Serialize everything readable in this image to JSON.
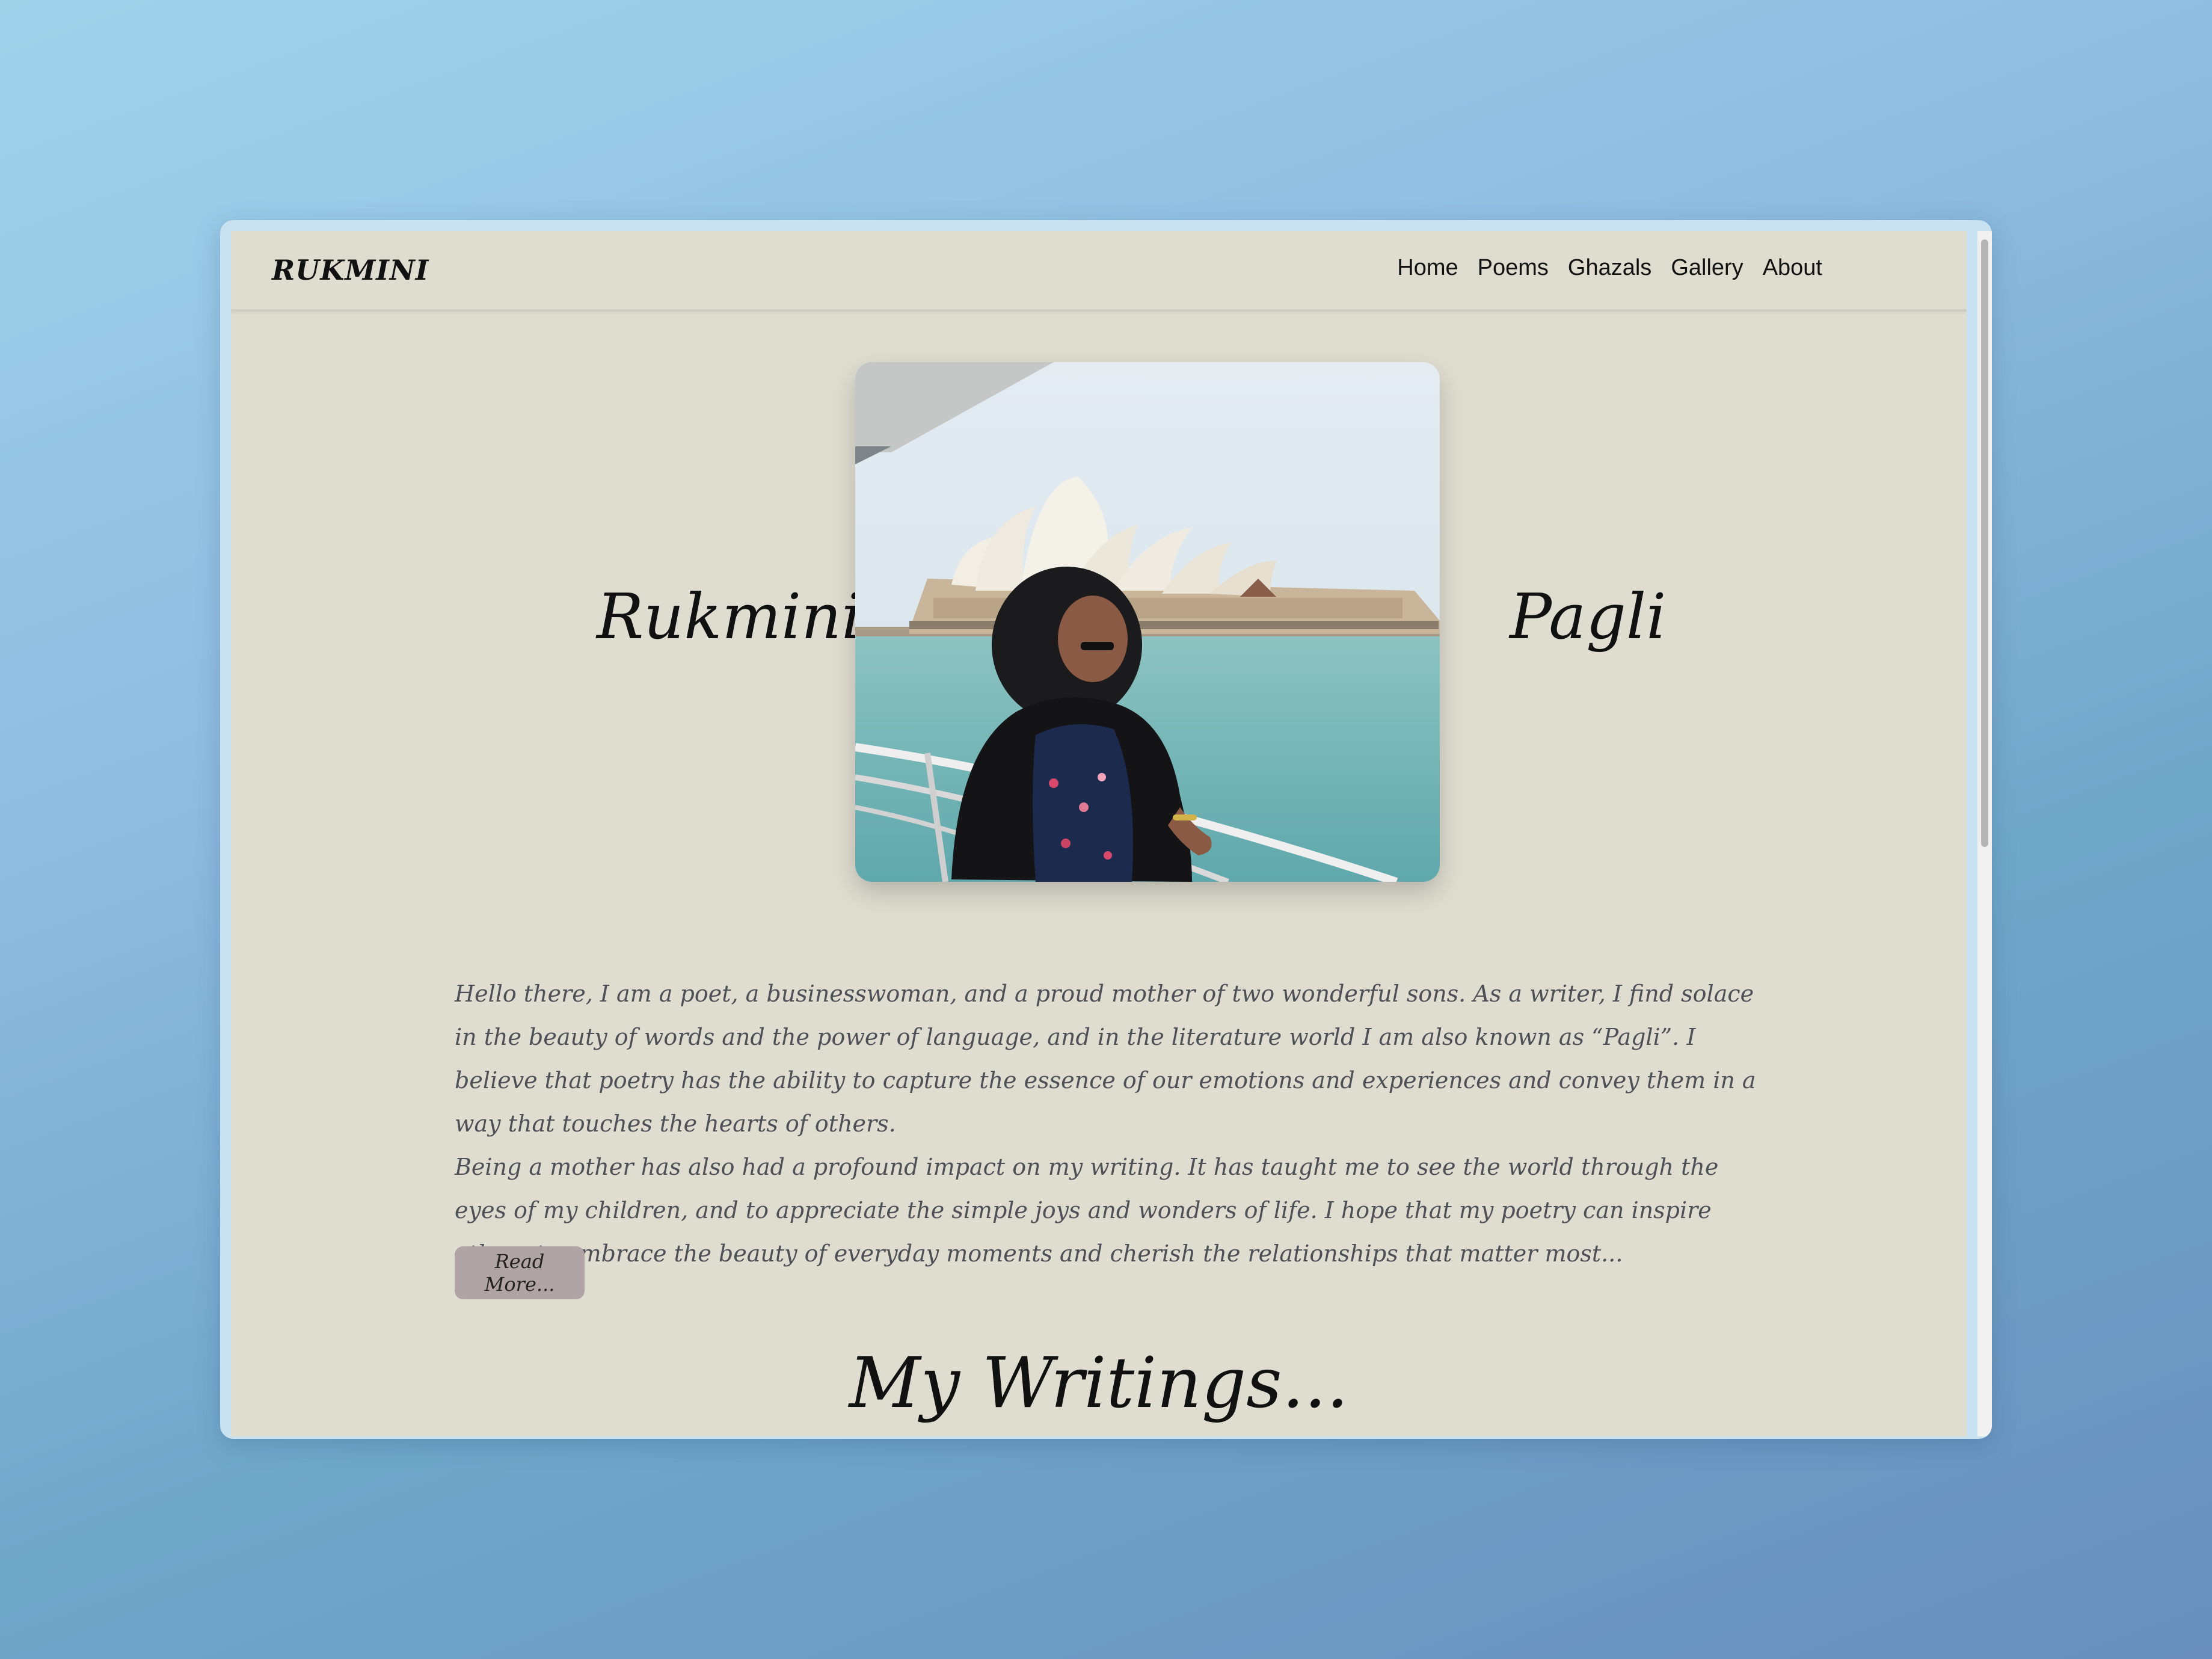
{
  "nav": {
    "brand": "RUKMINI",
    "links": [
      "Home",
      "Poems",
      "Ghazals",
      "Gallery",
      "About"
    ]
  },
  "hero": {
    "first_name": "Rukmini",
    "second_name": "Pagli"
  },
  "bio": {
    "paragraph1": "Hello there, I am a poet, a businesswoman, and a proud mother of two wonderful sons. As a writer, I find solace in the beauty of words and the power of language, and in the literature world I am also known as “Pagli”. I believe that poetry has the ability to capture the essence of our emotions and experiences and convey them in a way that touches the hearts of others.",
    "paragraph2": "Being a mother has also had a profound impact on my writing. It has taught me to see the world through the eyes of my children, and to appreciate the simple joys and wonders of life. I hope that my poetry can inspire others to embrace the beauty of everyday moments and cherish the relationships that matter most..."
  },
  "read_more_label": "Read More...",
  "section_title": "My Writings...",
  "colors": {
    "page_background": "#dfdcd0",
    "button_background": "#b1a4a6",
    "body_text": "#4f4f57"
  }
}
